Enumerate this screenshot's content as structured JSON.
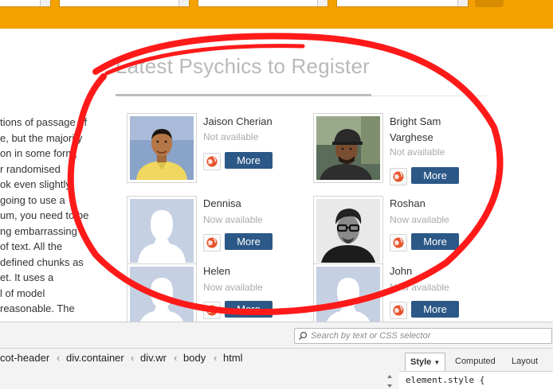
{
  "section": {
    "heading": "Latest Psychics to Register"
  },
  "side_text": [
    "tions of passage of",
    "e, but the majority",
    "on in some form,",
    "r randomised",
    "ok even slightly",
    "going to use a",
    "um, you need to be",
    "ng embarrassing",
    "of text. All the",
    "defined chunks as",
    "et. It uses a",
    "l of model",
    "reasonable. The"
  ],
  "psychics": [
    {
      "name_lines": [
        "Jaison Cherian"
      ],
      "status": "Not available",
      "more_label": "More",
      "photo": "man-yellow-shirt-photo"
    },
    {
      "name_lines": [
        "Bright Sam",
        "Varghese"
      ],
      "status": "Not available",
      "more_label": "More",
      "photo": "man-cap-photo"
    },
    {
      "name_lines": [
        "Dennisa"
      ],
      "status": "Now available",
      "more_label": "More",
      "photo": "default-avatar"
    },
    {
      "name_lines": [
        "Roshan"
      ],
      "status": "Now available",
      "more_label": "More",
      "photo": "man-glasses-photo"
    },
    {
      "name_lines": [
        "Helen"
      ],
      "status": "Now available",
      "more_label": "More",
      "photo": "default-avatar"
    },
    {
      "name_lines": [
        "John"
      ],
      "status": "Now available",
      "more_label": "More",
      "photo": "default-avatar"
    }
  ],
  "devtools": {
    "search_placeholder": "Search by text or CSS selector",
    "breadcrumbs": [
      "cot-header",
      "div.container",
      "div.wr",
      "body",
      "html"
    ],
    "tabs": {
      "style": "Style",
      "computed": "Computed",
      "layout": "Layout"
    },
    "code_line": "element.style {"
  },
  "colors": {
    "topbar": "#f5a100",
    "more_button": "#2b5886",
    "annotation": "#ff1a1a"
  }
}
